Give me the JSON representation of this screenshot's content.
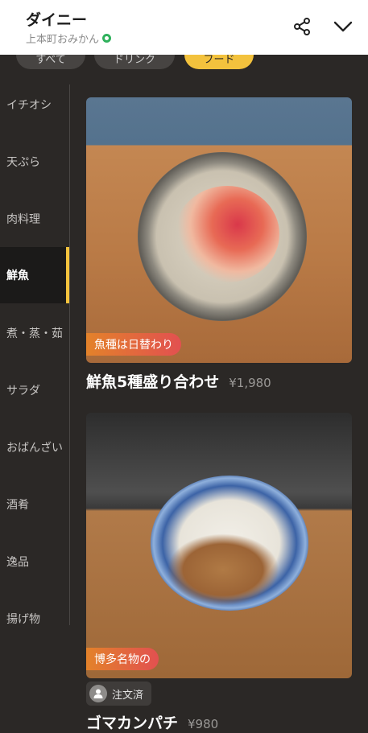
{
  "header": {
    "title": "ダイニー",
    "store_name": "上本町おみかん"
  },
  "top_tabs": [
    {
      "label": "すべて",
      "active": false
    },
    {
      "label": "ドリンク",
      "active": false
    },
    {
      "label": "フード",
      "active": true
    }
  ],
  "categories": [
    {
      "label": "イチオシ",
      "active": false
    },
    {
      "label": "天ぷら",
      "active": false
    },
    {
      "label": "肉料理",
      "active": false
    },
    {
      "label": "鮮魚",
      "active": true
    },
    {
      "label": "煮・蒸・茹",
      "active": false
    },
    {
      "label": "サラダ",
      "active": false
    },
    {
      "label": "おばんざい",
      "active": false
    },
    {
      "label": "酒肴",
      "active": false
    },
    {
      "label": "逸品",
      "active": false
    },
    {
      "label": "揚げ物",
      "active": false
    }
  ],
  "items": [
    {
      "tag": "魚種は日替わり",
      "name": "鮮魚5種盛り合わせ",
      "price": "¥1,980"
    },
    {
      "tag": "博多名物の",
      "ordered_label": "注文済",
      "name": "ゴマカンパチ",
      "price": "¥980"
    }
  ],
  "colors": {
    "accent": "#f3c23d",
    "background": "#2b2826",
    "tag_gradient_start": "#e3822a",
    "tag_gradient_end": "#e25050"
  },
  "icons": {
    "share": "share-icon",
    "collapse": "chevron-down-icon",
    "verified": "verified-badge-icon",
    "user": "user-icon"
  }
}
